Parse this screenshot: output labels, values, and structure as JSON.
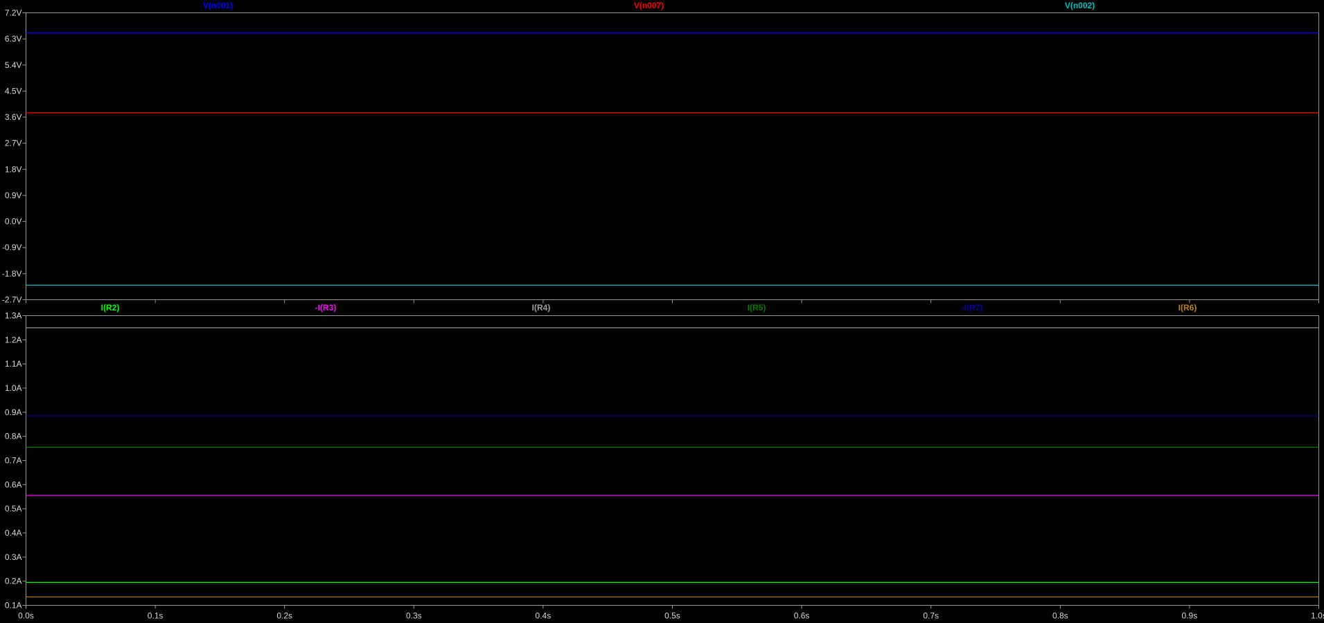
{
  "chart_data": [
    {
      "type": "line",
      "x_tick_labels": [],
      "y_tick_labels": [
        "7.2V",
        "6.3V",
        "5.4V",
        "4.5V",
        "3.6V",
        "2.7V",
        "1.8V",
        "0.9V",
        "0.0V",
        "-0.9V",
        "-1.8V",
        "-2.7V"
      ],
      "xlim": [
        0,
        1
      ],
      "ylim": [
        -2.7,
        7.2
      ],
      "x_ticks": [
        0,
        0.1,
        0.2,
        0.3,
        0.4,
        0.5,
        0.6,
        0.7,
        0.8,
        0.9,
        1.0
      ],
      "y_ticks": [
        7.2,
        6.3,
        5.4,
        4.5,
        3.6,
        2.7,
        1.8,
        0.9,
        0.0,
        -0.9,
        -1.8,
        -2.7
      ],
      "series": [
        {
          "name": "V(n001)",
          "color": "#0000ff",
          "x": [
            0,
            1
          ],
          "y": [
            6.5,
            6.5
          ]
        },
        {
          "name": "V(n007)",
          "color": "#ff0000",
          "x": [
            0,
            1
          ],
          "y": [
            3.75,
            3.75
          ]
        },
        {
          "name": "V(n002)",
          "color": "#00c0c0",
          "x": [
            0,
            1
          ],
          "y": [
            -2.2,
            -2.2
          ]
        }
      ]
    },
    {
      "type": "line",
      "x_tick_labels": [
        "0.0s",
        "0.1s",
        "0.2s",
        "0.3s",
        "0.4s",
        "0.5s",
        "0.6s",
        "0.7s",
        "0.8s",
        "0.9s",
        "1.0s"
      ],
      "y_tick_labels": [
        "1.3A",
        "1.2A",
        "1.1A",
        "1.0A",
        "0.9A",
        "0.8A",
        "0.7A",
        "0.6A",
        "0.5A",
        "0.4A",
        "0.3A",
        "0.2A",
        "0.1A"
      ],
      "xlim": [
        0,
        1
      ],
      "ylim": [
        0.1,
        1.3
      ],
      "x_ticks": [
        0,
        0.1,
        0.2,
        0.3,
        0.4,
        0.5,
        0.6,
        0.7,
        0.8,
        0.9,
        1.0
      ],
      "y_ticks": [
        1.3,
        1.2,
        1.1,
        1.0,
        0.9,
        0.8,
        0.7,
        0.6,
        0.5,
        0.4,
        0.3,
        0.2,
        0.1
      ],
      "series": [
        {
          "name": "I(R2)",
          "color": "#00ff00",
          "x": [
            0,
            1
          ],
          "y": [
            0.195,
            0.195
          ]
        },
        {
          "name": "-I(R3)",
          "color": "#ff00ff",
          "x": [
            0,
            1
          ],
          "y": [
            0.555,
            0.555
          ]
        },
        {
          "name": "I(R4)",
          "color": "#a0a0a0",
          "x": [
            0,
            1
          ],
          "y": [
            1.25,
            1.25
          ]
        },
        {
          "name": "I(R5)",
          "color": "#008000",
          "x": [
            0,
            1
          ],
          "y": [
            0.755,
            0.755
          ]
        },
        {
          "name": "-I(R7)",
          "color": "#0000a0",
          "x": [
            0,
            1
          ],
          "y": [
            0.885,
            0.885
          ]
        },
        {
          "name": "I(R6)",
          "color": "#c08000",
          "x": [
            0,
            1
          ],
          "y": [
            0.135,
            0.135
          ]
        }
      ]
    }
  ]
}
